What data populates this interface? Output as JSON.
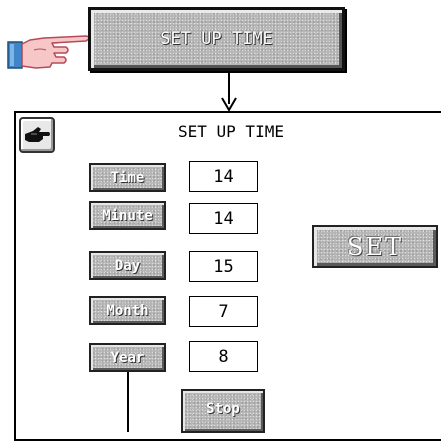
{
  "top_button": {
    "label": "SET UP TIME"
  },
  "panel": {
    "title": "SET UP TIME",
    "fields": [
      {
        "label": "Time",
        "value": "14"
      },
      {
        "label": "Minute",
        "value": "14"
      },
      {
        "label": "Day",
        "value": "15"
      },
      {
        "label": "Month",
        "value": "7"
      },
      {
        "label": "Year",
        "value": "8"
      }
    ],
    "set_label": "SET",
    "stop_label": "Stop"
  },
  "icons": {
    "pointer": "pointing-hand-icon",
    "panel_button": "hand-icon",
    "flow": "arrow-down-icon"
  },
  "colors": {
    "button_stone": "#b4b4b4",
    "outline": "#000000",
    "background": "#ffffff"
  }
}
